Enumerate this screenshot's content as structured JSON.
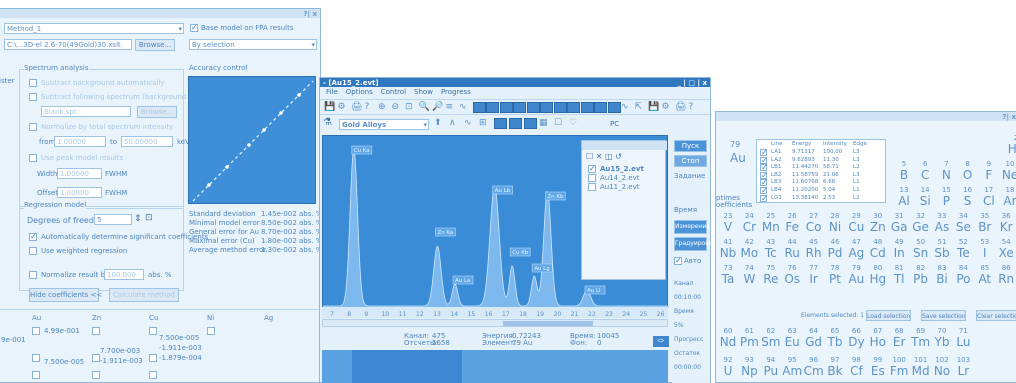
{
  "win_left": {
    "close_label": "?| x",
    "method_value": "Method_1",
    "file_value": "C:\\...3D-el 2.6-70(49Gold)30.xslt",
    "browse_label": "Browse...",
    "base_model_label": "Base model on FPA results",
    "by_selection_value": "By selection",
    "accuracy_control_label": "Accuracy control",
    "spectrum_analysis_label": "Spectrum analysis",
    "sa_opt1": "Subtract background automatically",
    "sa_opt2": "Subtract following spectrum (background spectrum):",
    "spectrum_file_value": "Blank.spt",
    "browse2_label": "Browse...",
    "sa_opt3": "Normalize by total spectrum intensity",
    "from_label": "from",
    "from_value": "1.00000",
    "to_label": "to",
    "to_value": "50.00000",
    "kev_label": "keV",
    "sa_opt4": "Use peak model results",
    "width_label": "Width",
    "width_value": "1.00000",
    "fwhm1": "FWHM",
    "offset_label": "Offset",
    "offset_value": "1.00000",
    "fwhm2": "FWHM",
    "regression_model_label": "Regression model",
    "degrees_label": "Degrees of freedom:",
    "degrees_value": "5",
    "auto_sig_label": "Automatically determine significant coefficients",
    "weighted_label": "Use weighted regression",
    "normalize_label": "Normalize result by",
    "normalize_value": "100.000",
    "normalize_unit": "abs. %",
    "hide_coeff_label": "Hide coefficients <<",
    "calc_label": "Calculate method",
    "stats": [
      {
        "label": "Standard deviation",
        "value": "1.45e-002 abs. %"
      },
      {
        "label": "Minimal model error",
        "value": "8.50e-002 abs. %"
      },
      {
        "label": "General error for Au",
        "value": "8.70e-002 abs. %"
      },
      {
        "label": "Maximal error (Cu)",
        "value": "1.80e-002 abs. %"
      },
      {
        "label": "Average method error",
        "value": "1.30e-002 abs. %"
      }
    ],
    "left_edge_label": "ister",
    "left_edge_label2": "ptes",
    "coef_headers": [
      "Au",
      "Zn",
      "Cu",
      "Ni",
      "Ag"
    ],
    "coef_row1": [
      "4.99e-001",
      "",
      "7.500e-005",
      ""
    ],
    "coef_row1_left": "9e-001",
    "coef_row2": [
      "7.500e-005",
      "7.700e-003",
      "-1.911e-003",
      ""
    ],
    "coef_row3": [
      "",
      "-1.911e-003",
      "-1.879e-004",
      ""
    ]
  },
  "win_mid": {
    "title": "- [Au15_2.evt]",
    "winctl": "_ | □ | x",
    "menu": [
      "File",
      "Options",
      "Control",
      "Show",
      "Progress"
    ],
    "preset_value": "Gold Alloys",
    "pc_label": "PC",
    "tree": [
      "Au15_2.evt",
      "Au14_2.evt",
      "Au11_2.evt"
    ],
    "peaks": [
      "Cu Ka",
      "Zn Ka",
      "Au La",
      "Au Lb",
      "Cu Kb",
      "Zn Kb",
      "Au Lg",
      "Au Ll"
    ],
    "x_ticks": [
      "7",
      "8",
      "9",
      "10",
      "11",
      "12",
      "13",
      "14",
      "15",
      "16",
      "17",
      "18",
      "19",
      "20",
      "21",
      "22",
      "23",
      "24",
      "25",
      "26"
    ],
    "status": {
      "k1": "Канал:",
      "v1": "475",
      "k2": "Энергия:",
      "v2": "0.72243",
      "k3": "Время:",
      "v3": "10045",
      "k4": "Отсчеты:",
      "v4": "5658",
      "k5": "Элемент:",
      "v5": "79 Au",
      "k6": "Фон:",
      "v6": "0"
    },
    "side_btn1": "Пуск",
    "side_btn2": "Стоп",
    "side_labels": [
      "Задание",
      "Время"
    ],
    "side_btns": [
      "Измерение",
      "Градуировка"
    ],
    "auto_label": "Авто",
    "rside": [
      "Канал",
      "00:10:00",
      "Время",
      "5%",
      "Прогресс",
      "Остаток",
      "00:00:00"
    ]
  },
  "win_right": {
    "close_label": "?| x",
    "line_headers": [
      "Line",
      "Energy",
      "Intensity",
      "Edge"
    ],
    "lines": [
      [
        "LA1",
        "9.71317",
        "100.00",
        "L3"
      ],
      [
        "LA2",
        "9.62893",
        "11.30",
        "L3"
      ],
      [
        "LB1",
        "11.44270",
        "58.71",
        "L2"
      ],
      [
        "LB2",
        "11.58759",
        "21.06",
        "L3"
      ],
      [
        "LB3",
        "11.60768",
        "6.66",
        "L1"
      ],
      [
        "LB4",
        "11.20200",
        "5.04",
        "L1"
      ],
      [
        "LG1",
        "13.38140",
        "2.53",
        "L2"
      ]
    ],
    "au_z": "79",
    "au_sym": "Au",
    "edge_labels": [
      "ptimes",
      "oefficients"
    ],
    "row1": [
      [
        "5",
        "B"
      ],
      [
        "6",
        "C"
      ],
      [
        "7",
        "N"
      ],
      [
        "8",
        "O"
      ],
      [
        "9",
        "F"
      ],
      [
        "10",
        "Ne"
      ]
    ],
    "row2": [
      [
        "13",
        "Al"
      ],
      [
        "14",
        "Si"
      ],
      [
        "15",
        "P"
      ],
      [
        "16",
        "S"
      ],
      [
        "17",
        "Cl"
      ],
      [
        "18",
        "Ar"
      ]
    ],
    "row3": [
      [
        "23",
        "V"
      ],
      [
        "24",
        "Cr"
      ],
      [
        "25",
        "Mn"
      ],
      [
        "26",
        "Fe"
      ],
      [
        "27",
        "Co"
      ],
      [
        "28",
        "Ni"
      ],
      [
        "29",
        "Cu"
      ],
      [
        "30",
        "Zn"
      ],
      [
        "31",
        "Ga"
      ],
      [
        "32",
        "Ge"
      ],
      [
        "33",
        "As"
      ],
      [
        "34",
        "Se"
      ],
      [
        "35",
        "Br"
      ],
      [
        "36",
        "Kr"
      ]
    ],
    "row4": [
      [
        "41",
        "Nb"
      ],
      [
        "42",
        "Mo"
      ],
      [
        "43",
        "Tc"
      ],
      [
        "44",
        "Ru"
      ],
      [
        "45",
        "Rh"
      ],
      [
        "46",
        "Pd"
      ],
      [
        "47",
        "Ag"
      ],
      [
        "48",
        "Cd"
      ],
      [
        "49",
        "In"
      ],
      [
        "50",
        "Sn"
      ],
      [
        "51",
        "Sb"
      ],
      [
        "52",
        "Te"
      ],
      [
        "53",
        "I"
      ],
      [
        "54",
        "Xe"
      ]
    ],
    "row5": [
      [
        "73",
        "Ta"
      ],
      [
        "74",
        "W"
      ],
      [
        "75",
        "Re"
      ],
      [
        "76",
        "Os"
      ],
      [
        "77",
        "Ir"
      ],
      [
        "78",
        "Pt"
      ],
      [
        "79",
        "Au"
      ],
      [
        "80",
        "Hg"
      ],
      [
        "81",
        "Tl"
      ],
      [
        "82",
        "Pb"
      ],
      [
        "83",
        "Bi"
      ],
      [
        "84",
        "Po"
      ],
      [
        "85",
        "At"
      ],
      [
        "86",
        "Rn"
      ]
    ],
    "row6": [
      [
        "60",
        "Nd"
      ],
      [
        "61",
        "Pm"
      ],
      [
        "62",
        "Sm"
      ],
      [
        "63",
        "Eu"
      ],
      [
        "64",
        "Gd"
      ],
      [
        "65",
        "Tb"
      ],
      [
        "66",
        "Dy"
      ],
      [
        "67",
        "Ho"
      ],
      [
        "68",
        "Er"
      ],
      [
        "69",
        "Tm"
      ],
      [
        "70",
        "Yb"
      ],
      [
        "71",
        "Lu"
      ]
    ],
    "row7": [
      [
        "92",
        "U"
      ],
      [
        "93",
        "Np"
      ],
      [
        "94",
        "Pu"
      ],
      [
        "95",
        "Am"
      ],
      [
        "96",
        "Cm"
      ],
      [
        "97",
        "Bk"
      ],
      [
        "98",
        "Cf"
      ],
      [
        "99",
        "Es"
      ],
      [
        "100",
        "Fm"
      ],
      [
        "101",
        "Md"
      ],
      [
        "102",
        "No"
      ],
      [
        "103",
        "Lr"
      ]
    ],
    "r1_top": [
      [
        "2",
        "He"
      ]
    ],
    "btn_load": "Load selection",
    "btn_save": "Save selection",
    "btn_clear": "Clear selection",
    "elements_selected": "Elements selected: 1"
  }
}
